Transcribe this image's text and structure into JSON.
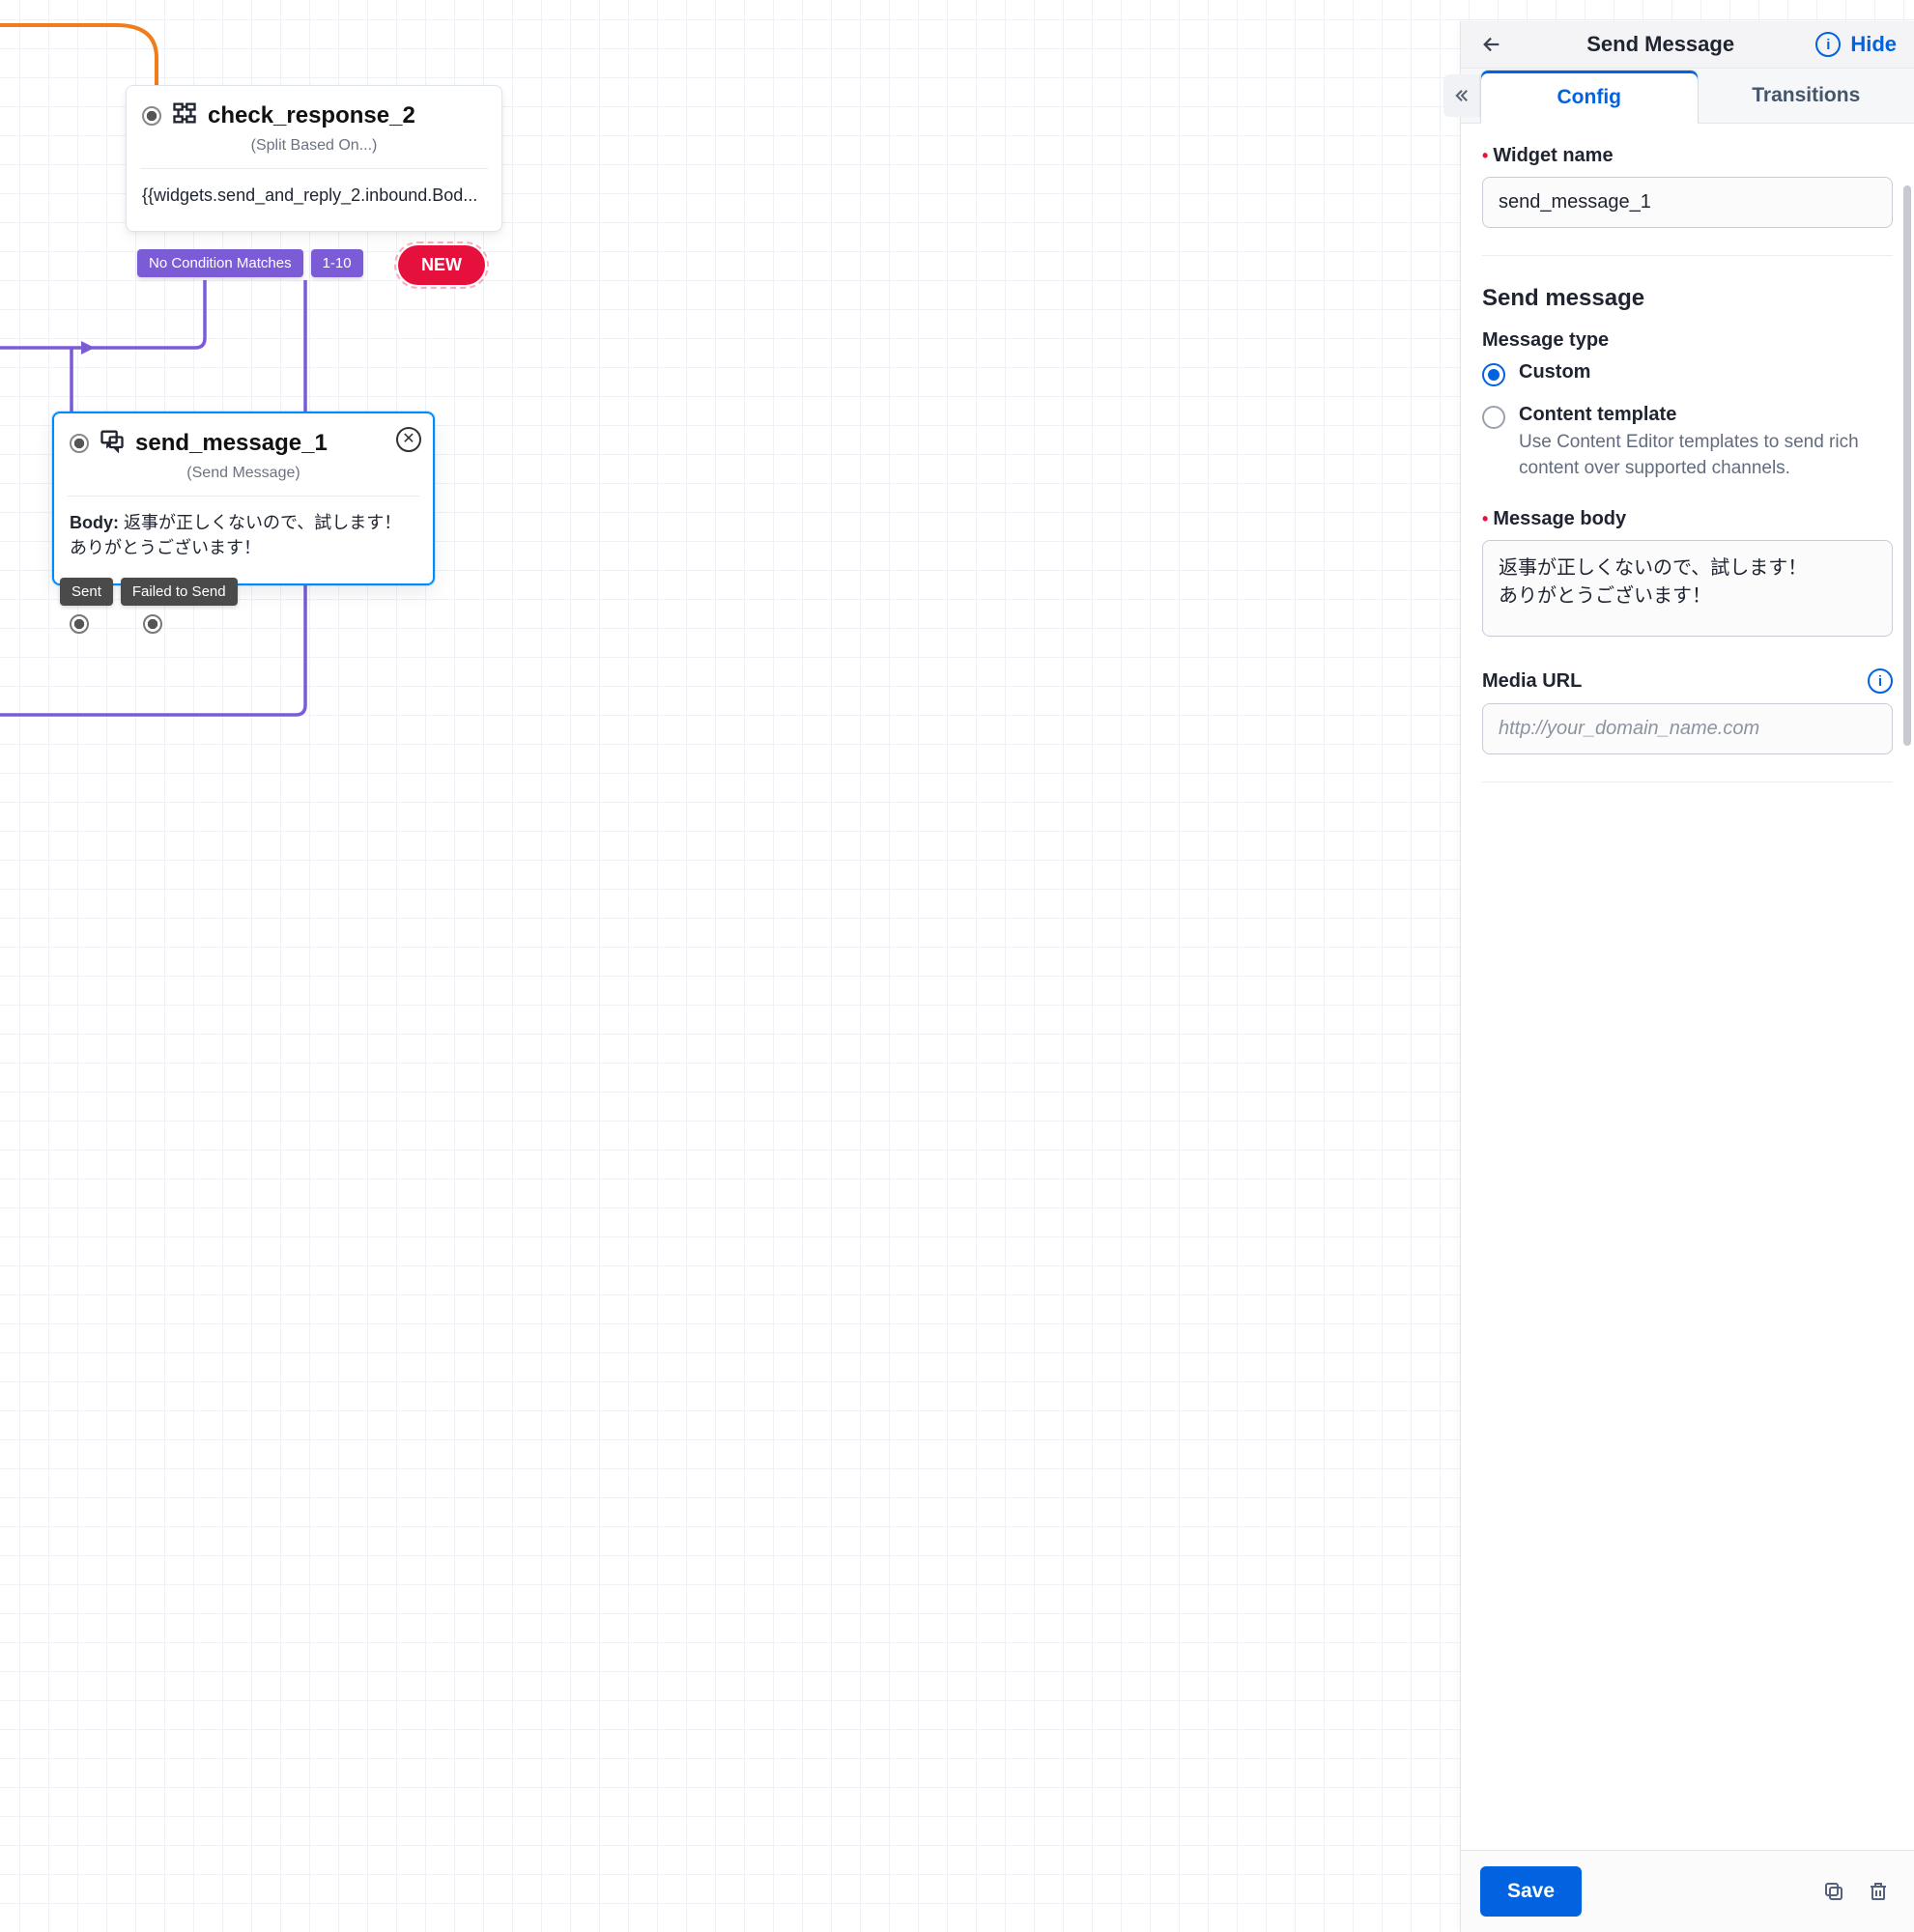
{
  "colors": {
    "primary": "#0263e0",
    "accent_purple": "#7b5bd6",
    "danger": "#e6103d"
  },
  "canvas": {
    "widget_split": {
      "title": "check_response_2",
      "subtitle": "(Split Based On...)",
      "body_expr": "{{widgets.send_and_reply_2.inbound.Bod...",
      "chips": {
        "no_match": "No Condition Matches",
        "range": "1-10"
      },
      "new_pill": "NEW"
    },
    "widget_send": {
      "title": "send_message_1",
      "subtitle": "(Send Message)",
      "body_label": "Body:",
      "body_value": "返事が正しくないので、試します！ありがとうございます！",
      "chips": {
        "sent": "Sent",
        "failed": "Failed to Send"
      }
    }
  },
  "panel": {
    "header": {
      "title": "Send Message",
      "hide": "Hide"
    },
    "tabs": {
      "config": "Config",
      "transitions": "Transitions"
    },
    "widget_name": {
      "label": "Widget name",
      "value": "send_message_1"
    },
    "section_title": "Send message",
    "message_type": {
      "label": "Message type",
      "custom": "Custom",
      "template": "Content template",
      "template_desc": "Use Content Editor templates to send rich content over supported channels."
    },
    "message_body": {
      "label": "Message body",
      "value": "返事が正しくないので、試します！\nありがとうございます！"
    },
    "media_url": {
      "label": "Media URL",
      "placeholder": "http://your_domain_name.com"
    },
    "footer": {
      "save": "Save"
    }
  }
}
